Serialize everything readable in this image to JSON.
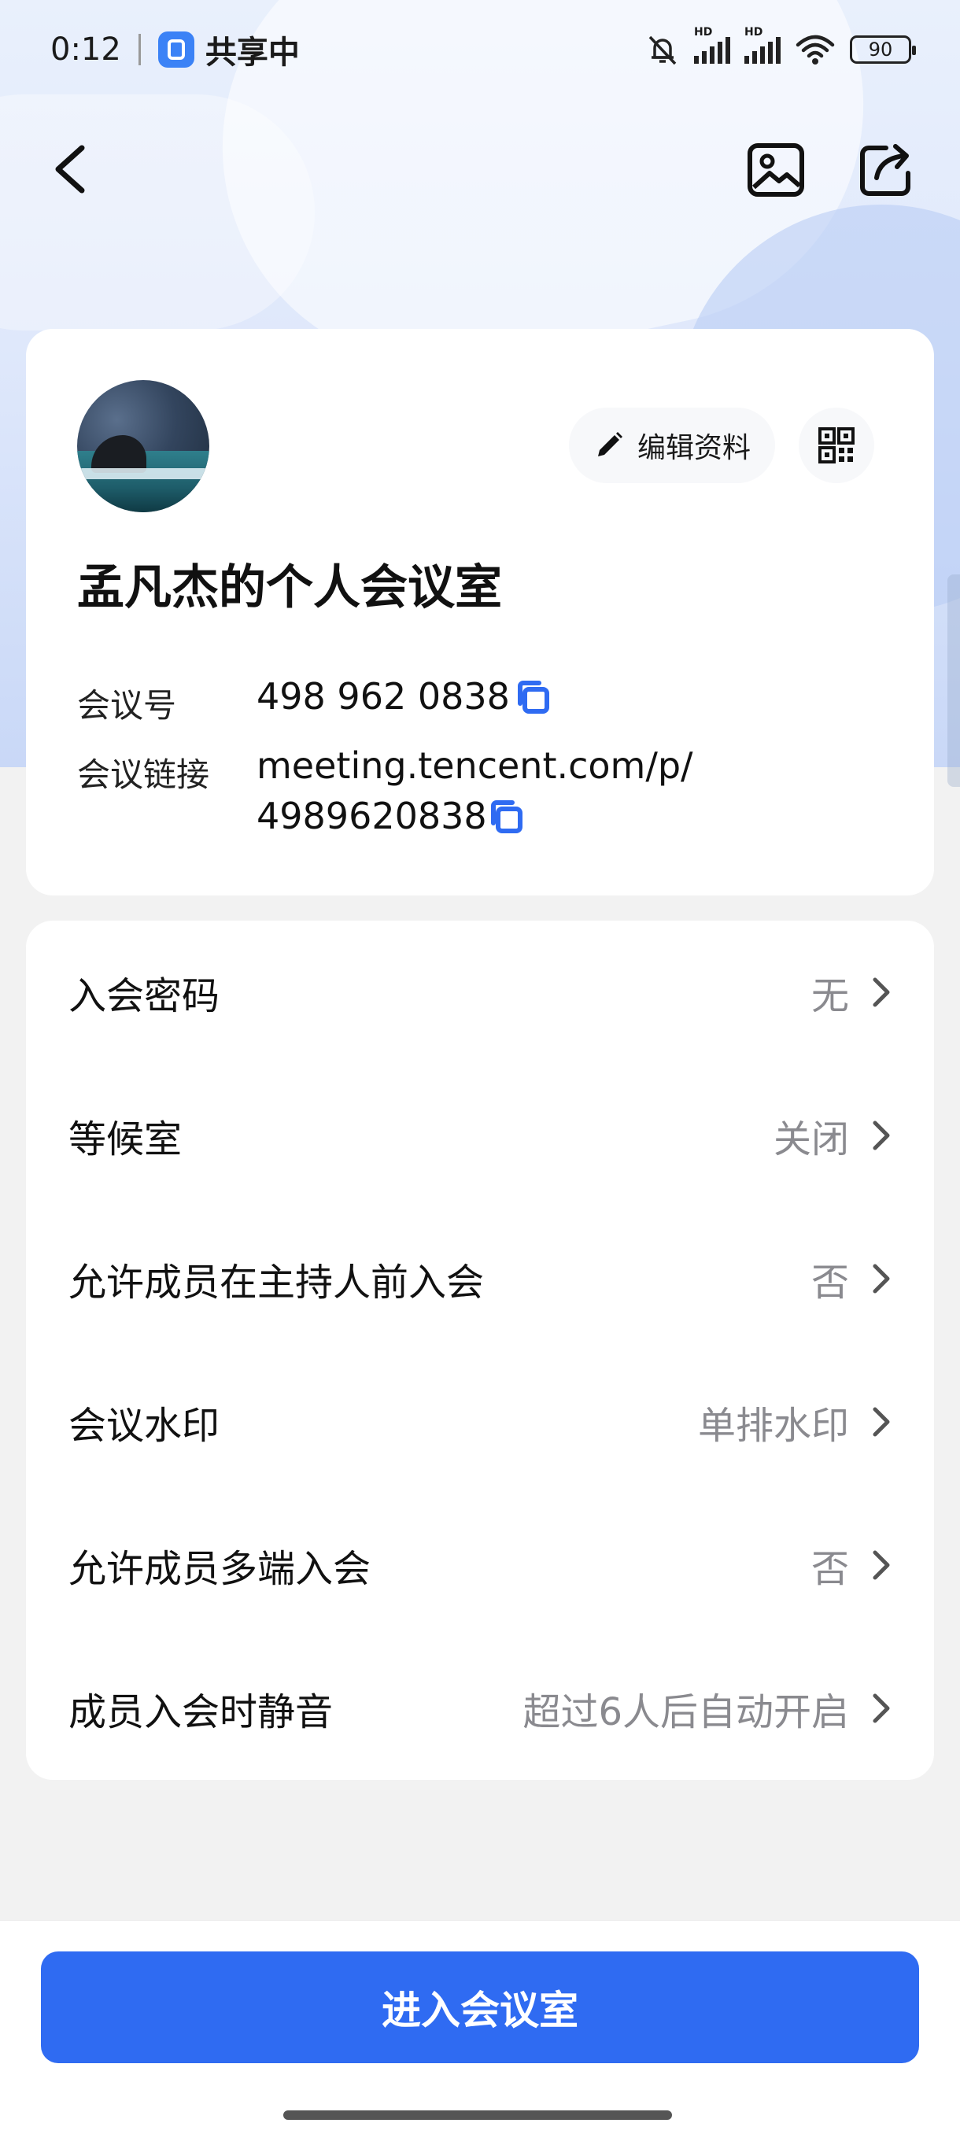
{
  "status_bar": {
    "time": "0:12",
    "sharing_label": "共享中",
    "battery": "90",
    "hd1": "HD",
    "hd2": "HD"
  },
  "nav": {
    "back_icon": "chevron-left-icon",
    "image_icon": "image-icon",
    "share_icon": "share-icon"
  },
  "profile": {
    "edit_label": "编辑资料",
    "room_title": "孟凡杰的个人会议室",
    "meeting_id_label": "会议号",
    "meeting_id": "498 962 0838",
    "link_label": "会议链接",
    "link_line1": "meeting.tencent.com/p/",
    "link_line2": "4989620838"
  },
  "settings": [
    {
      "label": "入会密码",
      "value": "无"
    },
    {
      "label": "等候室",
      "value": "关闭"
    },
    {
      "label": "允许成员在主持人前入会",
      "value": "否"
    },
    {
      "label": "会议水印",
      "value": "单排水印"
    },
    {
      "label": "允许成员多端入会",
      "value": "否"
    },
    {
      "label": "成员入会时静音",
      "value": "超过6人后自动开启"
    }
  ],
  "enter_button": "进入会议室",
  "colors": {
    "primary": "#2f6bf2",
    "copy_icon": "#2f6bf2",
    "muted_text": "#8a8a8f"
  }
}
